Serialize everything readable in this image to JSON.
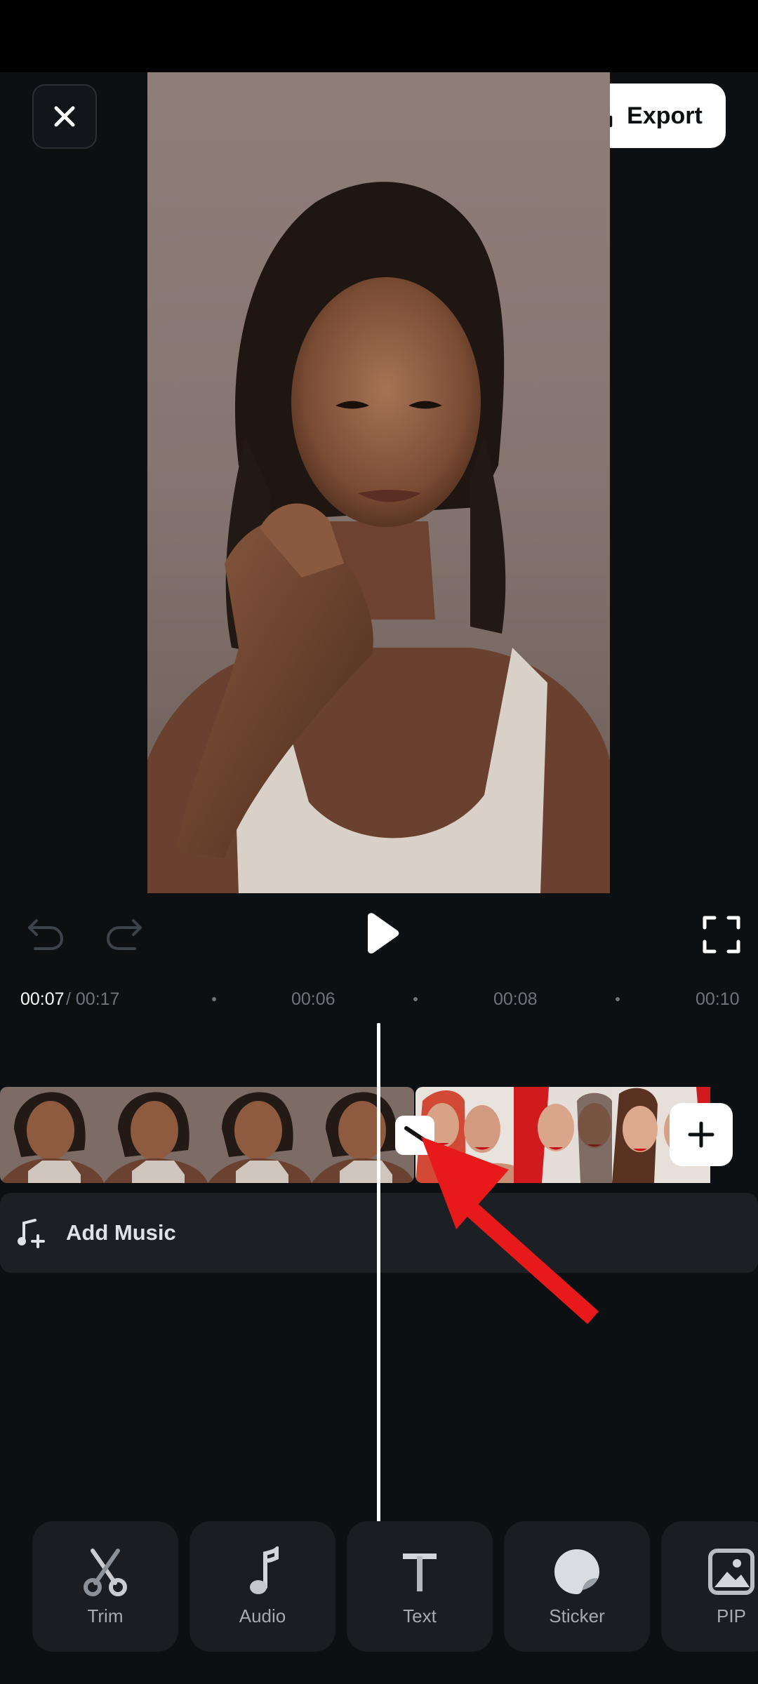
{
  "header": {
    "export_label": "Export"
  },
  "timeline": {
    "current_time": "00:07",
    "total_time": " / 00:17",
    "ruler": [
      "00:06",
      "00:08",
      "00:10"
    ],
    "add_music_label": "Add Music"
  },
  "toolbar": {
    "items": [
      {
        "label": "Trim",
        "icon": "scissors-icon"
      },
      {
        "label": "Audio",
        "icon": "music-note-icon"
      },
      {
        "label": "Text",
        "icon": "text-icon"
      },
      {
        "label": "Sticker",
        "icon": "sticker-icon"
      },
      {
        "label": "PIP",
        "icon": "image-icon"
      }
    ]
  },
  "colors": {
    "background": "#0d1013",
    "panel": "#1c1f23",
    "annotation": "#e8191b",
    "accent_white": "#ffffff"
  }
}
